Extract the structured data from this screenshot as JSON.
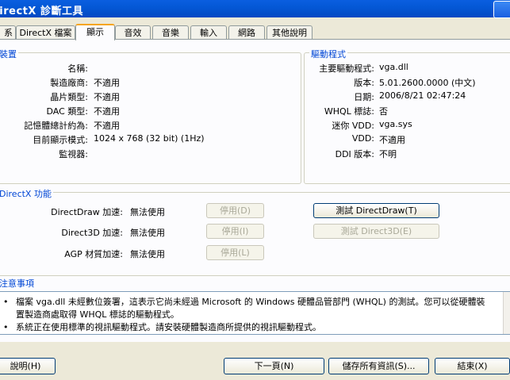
{
  "window": {
    "title": "DirectX 診斷工具"
  },
  "tabs": [
    {
      "label": "系統"
    },
    {
      "label": "DirectX 檔案"
    },
    {
      "label": "顯示"
    },
    {
      "label": "音效"
    },
    {
      "label": "音樂"
    },
    {
      "label": "輸入"
    },
    {
      "label": "網路"
    },
    {
      "label": "其他說明"
    }
  ],
  "device": {
    "title": "裝置",
    "rows": [
      {
        "label": "名稱:",
        "value": ""
      },
      {
        "label": "製造廠商:",
        "value": "不適用"
      },
      {
        "label": "晶片類型:",
        "value": "不適用"
      },
      {
        "label": "DAC 類型:",
        "value": "不適用"
      },
      {
        "label": "記憶體總計約為:",
        "value": "不適用"
      },
      {
        "label": "目前顯示模式:",
        "value": "1024 x 768 (32 bit) (1Hz)"
      },
      {
        "label": "監視器:",
        "value": ""
      }
    ]
  },
  "drivers": {
    "title": "驅動程式",
    "rows": [
      {
        "label": "主要驅動程式:",
        "value": "vga.dll"
      },
      {
        "label": "版本:",
        "value": "5.01.2600.0000 (中文)"
      },
      {
        "label": "日期:",
        "value": "2006/8/21 02:47:24"
      },
      {
        "label": "WHQL 標誌:",
        "value": "否"
      },
      {
        "label": "迷你 VDD:",
        "value": "vga.sys"
      },
      {
        "label": "VDD:",
        "value": "不適用"
      },
      {
        "label": "DDI 版本:",
        "value": "不明"
      }
    ]
  },
  "features": {
    "title": "DirectX 功能",
    "rows": [
      {
        "label": "DirectDraw 加速:",
        "value": "無法使用",
        "disable_btn": "停用(D)",
        "test_btn": "測試 DirectDraw(T)"
      },
      {
        "label": "Direct3D 加速:",
        "value": "無法使用",
        "disable_btn": "停用(I)",
        "test_btn": "測試 Direct3D(E)"
      },
      {
        "label": "AGP 材質加速:",
        "value": "無法使用",
        "disable_btn": "停用(L)"
      }
    ]
  },
  "notes": {
    "title": "注意事項",
    "items": [
      "檔案 vga.dll 未經數位簽署，這表示它尚未經過 Microsoft 的 Windows 硬體品管部門 (WHQL) 的測試。您可以從硬體裝",
      "置製造商處取得 WHQL 標誌的驅動程式。",
      "系統正在使用標準的視訊驅動程式。請安裝硬體製造商所提供的視訊驅動程式。"
    ]
  },
  "buttons": {
    "help": "說明(H)",
    "next": "下一頁(N)",
    "save": "儲存所有資訊(S)...",
    "exit": "結束(X)"
  }
}
